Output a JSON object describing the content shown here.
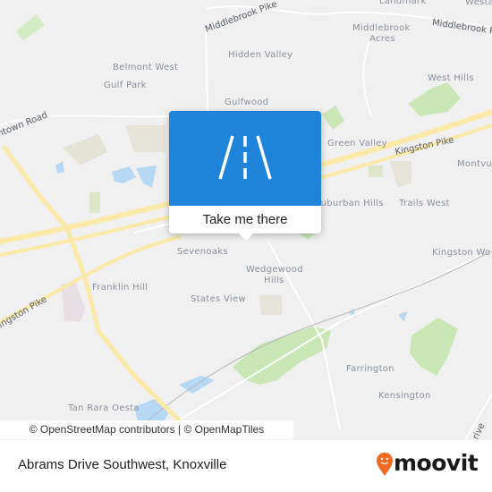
{
  "map": {
    "places": [
      {
        "id": "landmark",
        "name": "Landmark"
      },
      {
        "id": "westa",
        "name": "Westa"
      },
      {
        "id": "belmont-west",
        "name": "Belmont West"
      },
      {
        "id": "gulf-park",
        "name": "Gulf Park"
      },
      {
        "id": "hidden-valley",
        "name": "Hidden Valley"
      },
      {
        "id": "middlebrook-acres-1",
        "name": "Middlebrook"
      },
      {
        "id": "middlebrook-acres-2",
        "name": "Acres"
      },
      {
        "id": "west-hills",
        "name": "West Hills"
      },
      {
        "id": "gulfwood",
        "name": "Gulfwood"
      },
      {
        "id": "green-valley",
        "name": "Green Valley"
      },
      {
        "id": "montvue",
        "name": "Montvu"
      },
      {
        "id": "suburban-hills",
        "name": "Suburban Hills"
      },
      {
        "id": "trails-west",
        "name": "Trails West"
      },
      {
        "id": "kingston-woods",
        "name": "Kingston Wo"
      },
      {
        "id": "sevenoaks",
        "name": "Sevenoaks"
      },
      {
        "id": "wedgewood-hills-1",
        "name": "Wedgewood"
      },
      {
        "id": "wedgewood-hills-2",
        "name": "Hills"
      },
      {
        "id": "franklin-hill",
        "name": "Franklin Hill"
      },
      {
        "id": "states-view",
        "name": "States View"
      },
      {
        "id": "farrington",
        "name": "Farrington"
      },
      {
        "id": "kensington",
        "name": "Kensington"
      },
      {
        "id": "tan-rara-oesta",
        "name": "Tan Rara Oesta"
      }
    ],
    "roads": [
      {
        "id": "middlebrook-pike-1",
        "name": "Middlebrook Pike"
      },
      {
        "id": "middlebrook-pike-2",
        "name": "Middlebrook Pike"
      },
      {
        "id": "kingston-pike-1",
        "name": "Kingston Pike"
      },
      {
        "id": "kingston-pike-2",
        "name": "Kingston Pike"
      },
      {
        "id": "gallaher-road",
        "name": "ntown Road"
      },
      {
        "id": "drive",
        "name": "rive"
      }
    ]
  },
  "popup": {
    "icon": "road-icon",
    "button_label": "Take me there"
  },
  "attribution": "© OpenStreetMap contributors | © OpenMapTiles",
  "footer": {
    "address": "Abrams Drive Southwest, Knoxville",
    "brand": "moovit",
    "brand_color": "#f26a21"
  }
}
